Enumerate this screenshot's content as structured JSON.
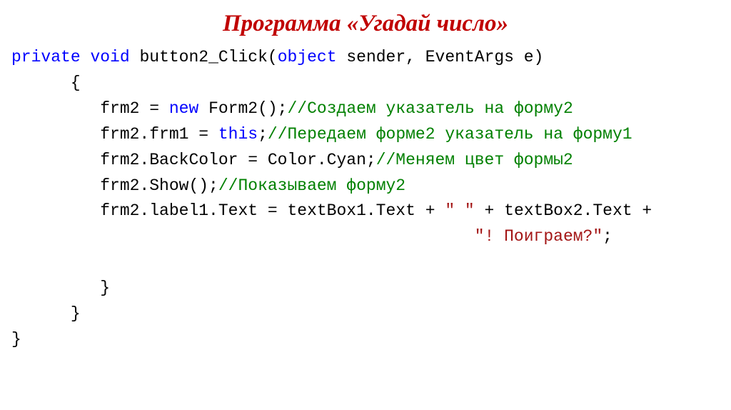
{
  "title": "Программа «Угадай число»",
  "code": {
    "kw_private": "private",
    "kw_void": "void",
    "method": " button2_Click(",
    "kw_object": "object",
    "sig_rest": " sender, EventArgs e)",
    "brace_open1": "      {",
    "l3_a": "         frm2 = ",
    "kw_new": "new",
    "l3_b": " Form2();",
    "cm1": "//Создаем указатель на форму2",
    "l4_a": "         frm2.frm1 = ",
    "kw_this": "this",
    "l4_b": ";",
    "cm2": "//Передаем форме2 указатель на форму1",
    "l5_a": "         frm2.BackColor = Color.Cyan;",
    "cm3": "//Меняем цвет формы2",
    "l6_a": "         frm2.Show();",
    "cm4": "//Показываем форму2",
    "l7_a": "         frm2.label1.Text = textBox1.Text + ",
    "str_space": "\" \"",
    "l7_b": " + textBox2.Text +",
    "l8_pad": "                                               ",
    "str_play": "\"! Поиграем?\"",
    "l8_semi": ";",
    "brace_close1": "         }",
    "brace_close2": "      }",
    "brace_close3": "}"
  }
}
